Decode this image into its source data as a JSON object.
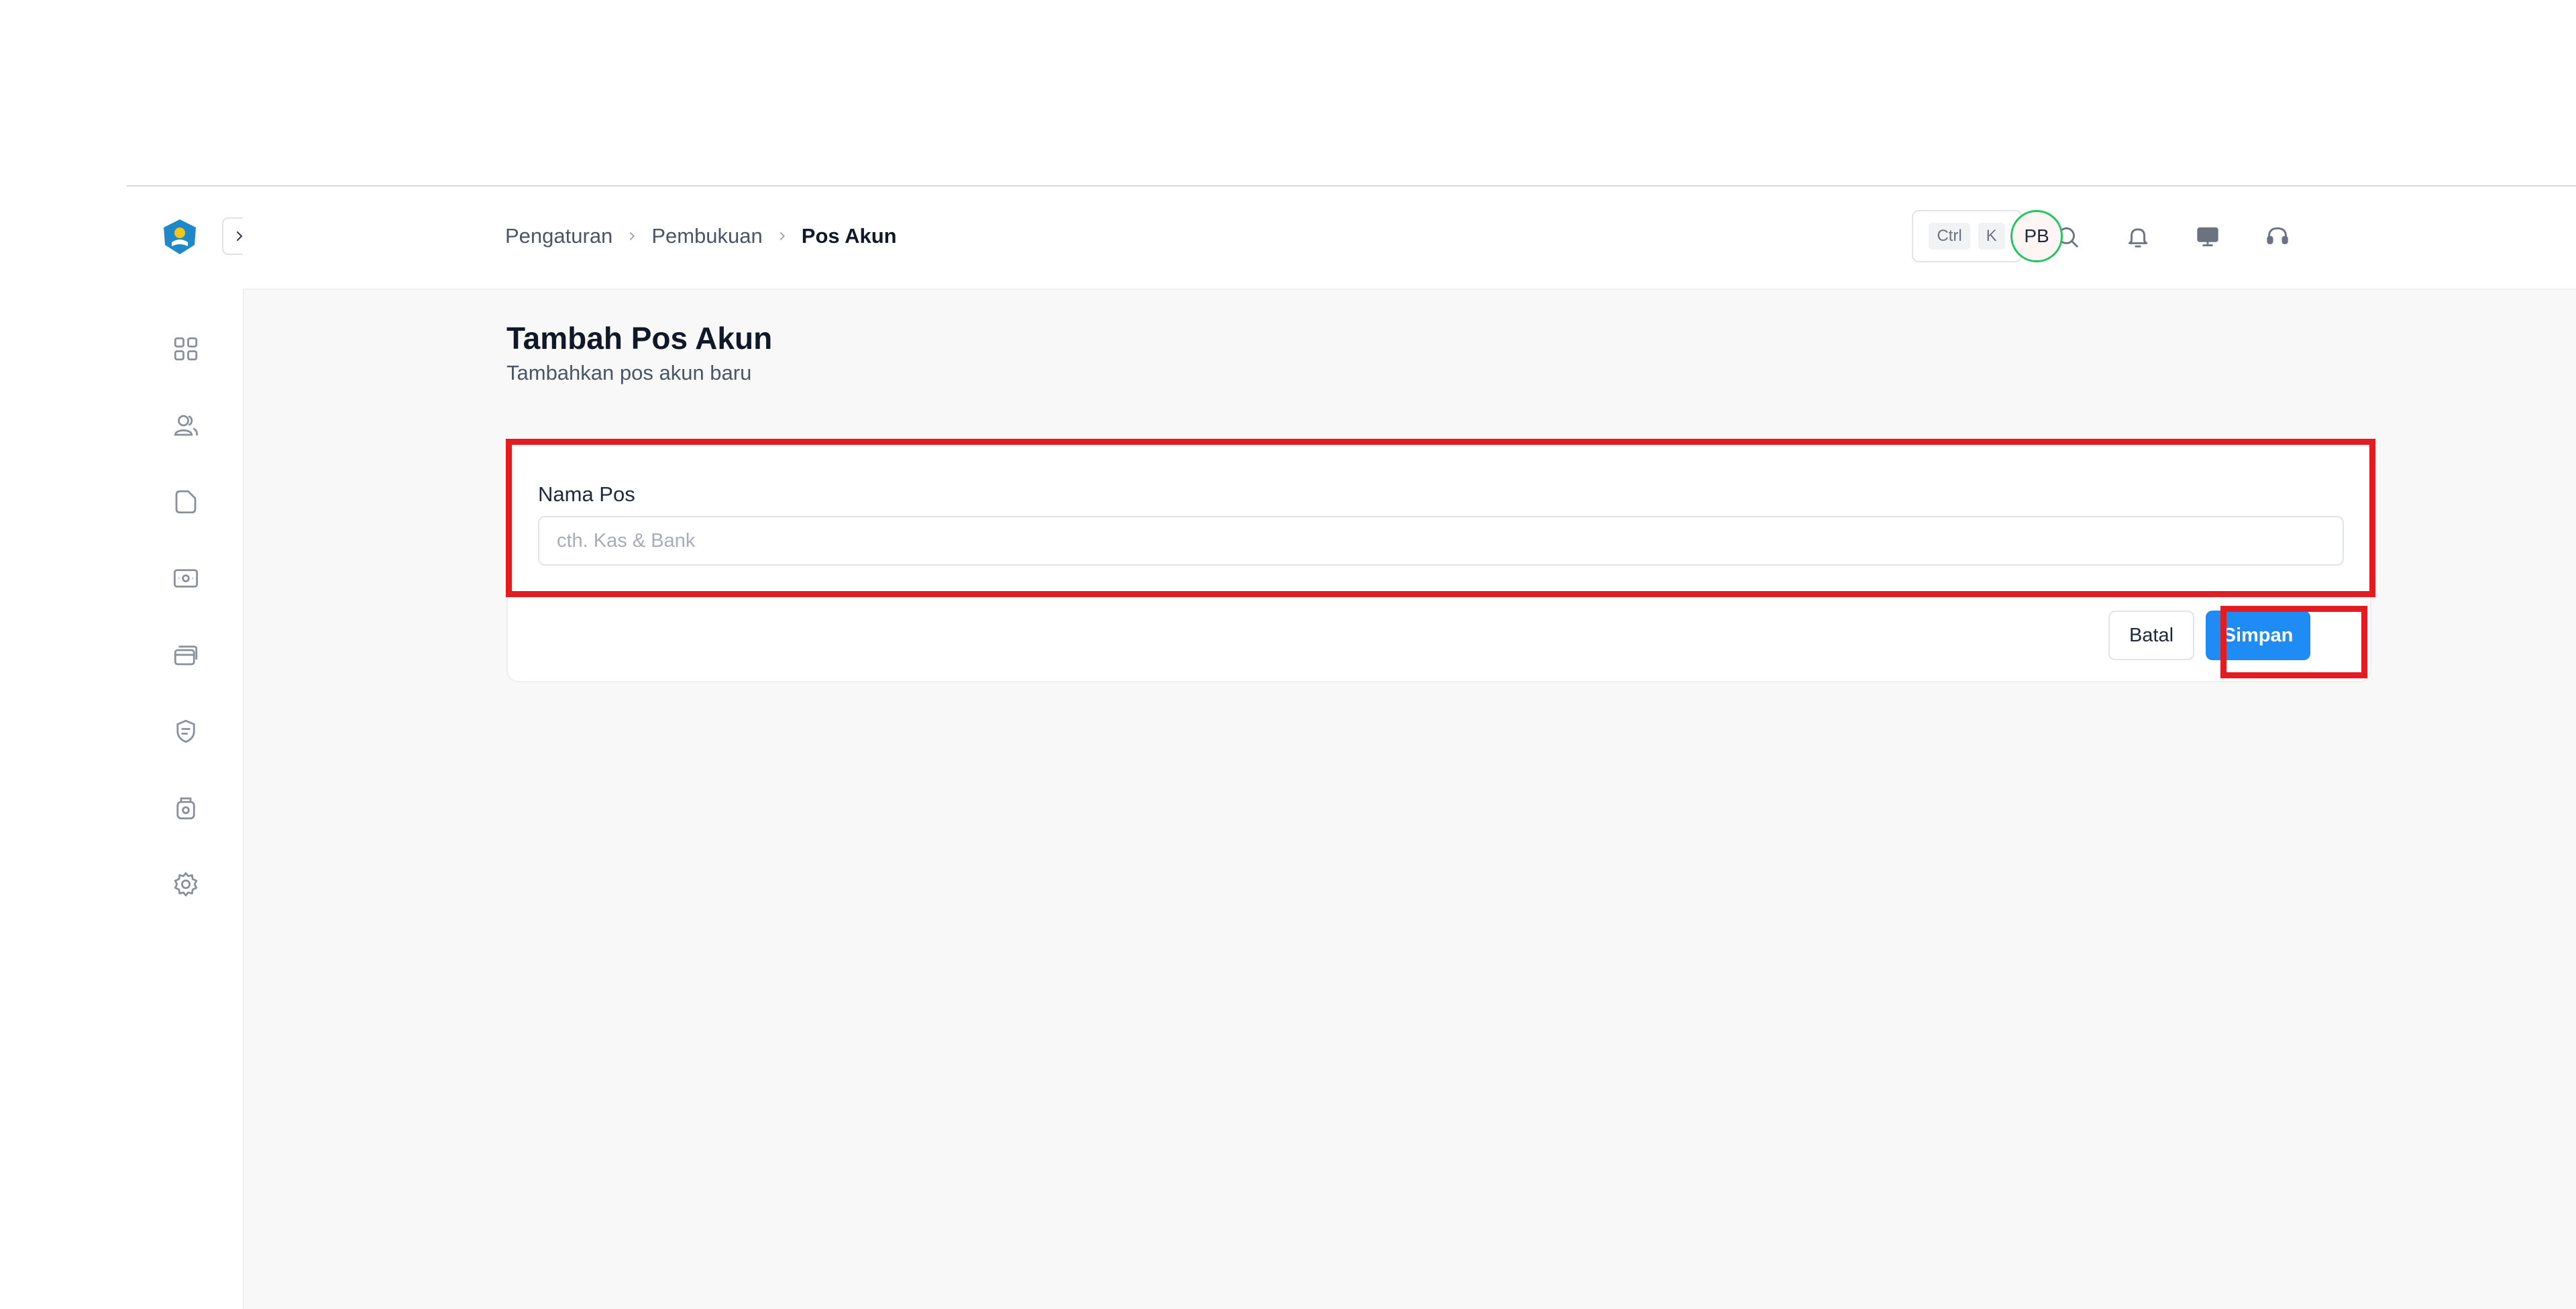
{
  "breadcrumb": [
    "Pengaturan",
    "Pembukuan",
    "Pos Akun"
  ],
  "shortcut": {
    "key1": "Ctrl",
    "key2": "K"
  },
  "user": {
    "initials": "PB"
  },
  "page": {
    "title": "Tambah Pos Akun",
    "subtitle": "Tambahkan pos akun baru"
  },
  "form": {
    "field_label": "Nama Pos",
    "field_placeholder": "cth. Kas & Bank",
    "field_value": "",
    "cancel_label": "Batal",
    "save_label": "Simpan"
  },
  "sidebar": {
    "icons": [
      "dashboard-icon",
      "users-icon",
      "file-icon",
      "cash-icon",
      "card-icon",
      "badge-icon",
      "archive-icon",
      "gear-icon"
    ]
  },
  "colors": {
    "primary": "#1f8bf5",
    "avatar_ring": "#22c55e",
    "highlight": "#e31b23"
  }
}
